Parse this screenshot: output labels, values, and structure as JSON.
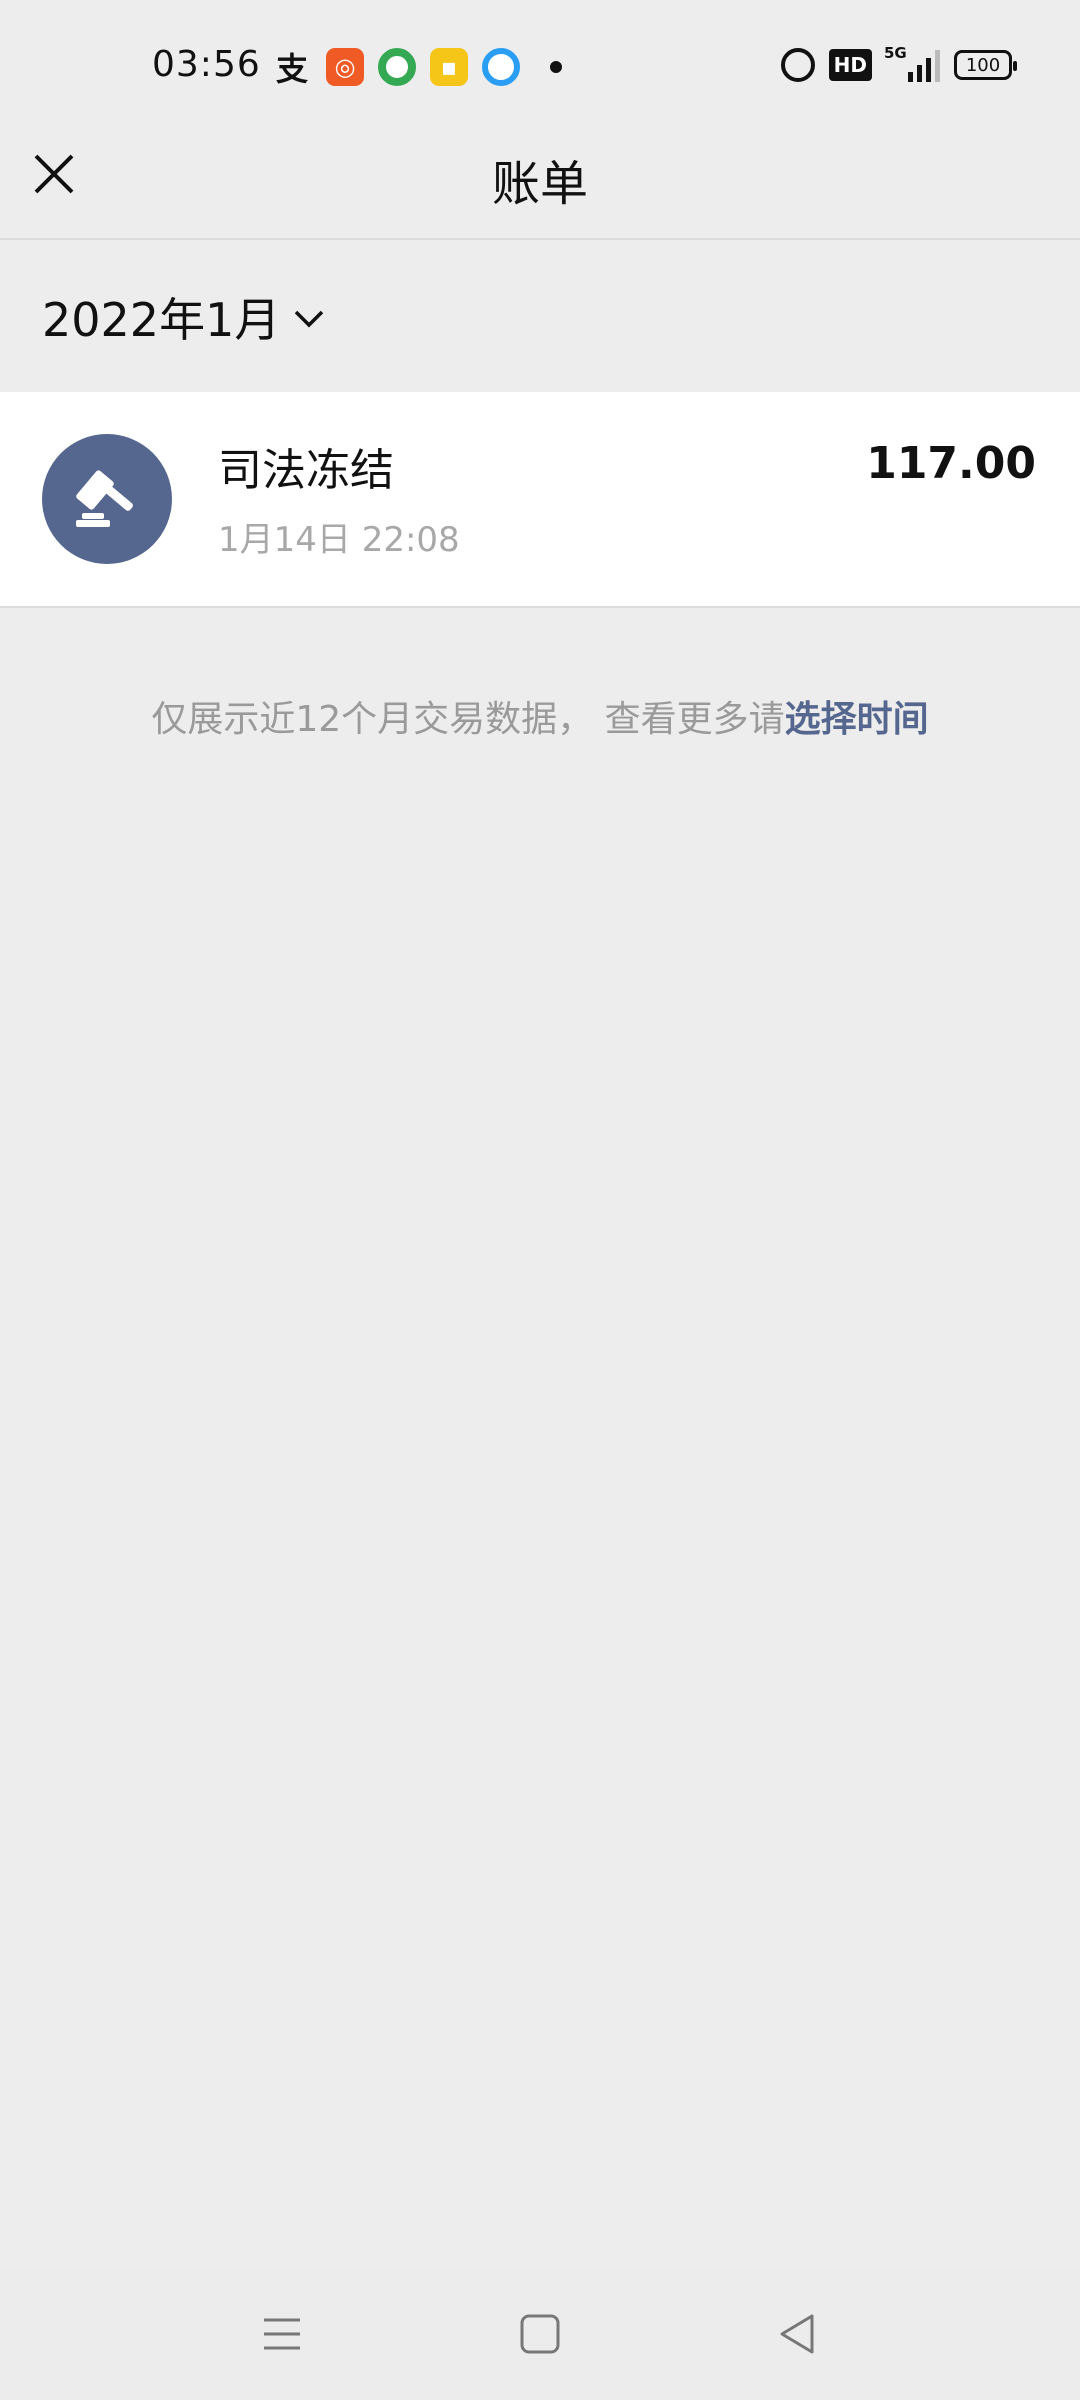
{
  "status_bar": {
    "time": "03:56",
    "alipay_glyph": "支",
    "signal_label": "5G",
    "battery": "100"
  },
  "title_bar": {
    "title": "账单",
    "close_icon": "close-icon"
  },
  "filter": {
    "month": "2022年1月",
    "chevron_icon": "chevron-down-icon"
  },
  "bills": [
    {
      "icon": "gavel-icon",
      "title": "司法冻结",
      "time": "1月14日 22:08",
      "amount": "117.00"
    }
  ],
  "footer": {
    "note": "仅展示近12个月交易数据， 查看更多请",
    "link": "选择时间"
  },
  "colors": {
    "accent": "#56678f",
    "background": "#ededed",
    "card": "#ffffff"
  },
  "nav_bar": {
    "menu_icon": "menu-icon",
    "home_icon": "home-icon",
    "back_icon": "back-icon"
  }
}
